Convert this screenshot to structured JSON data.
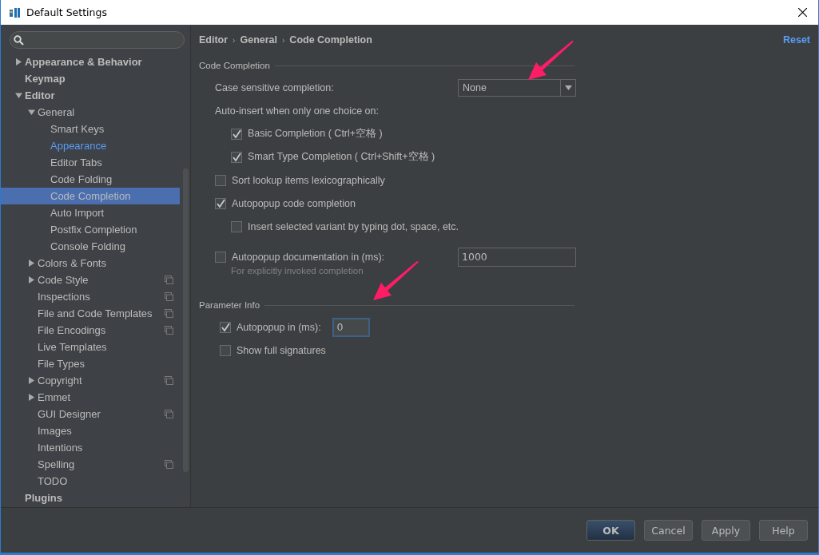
{
  "window": {
    "title": "Default Settings"
  },
  "tree": [
    {
      "label": "Appearance & Behavior",
      "kind": "closed",
      "selected": false,
      "modified": false,
      "project_level": false
    },
    {
      "label": "Keymap",
      "kind": "page",
      "selected": false,
      "modified": false,
      "project_level": false
    },
    {
      "label": "Editor",
      "kind": "open",
      "selected": false,
      "modified": false,
      "project_level": false,
      "children": [
        {
          "label": "General",
          "kind": "open",
          "selected": false,
          "modified": false,
          "project_level": false,
          "children": [
            {
              "label": "Smart Keys",
              "selected": false,
              "modified": false,
              "project_level": false
            },
            {
              "label": "Appearance",
              "selected": false,
              "modified": true,
              "project_level": false
            },
            {
              "label": "Editor Tabs",
              "selected": false,
              "modified": false,
              "project_level": false
            },
            {
              "label": "Code Folding",
              "selected": false,
              "modified": false,
              "project_level": false
            },
            {
              "label": "Code Completion",
              "selected": true,
              "modified": false,
              "project_level": false
            },
            {
              "label": "Auto Import",
              "selected": false,
              "modified": false,
              "project_level": false
            },
            {
              "label": "Postfix Completion",
              "selected": false,
              "modified": false,
              "project_level": false
            },
            {
              "label": "Console Folding",
              "selected": false,
              "modified": false,
              "project_level": false
            }
          ]
        },
        {
          "label": "Colors & Fonts",
          "kind": "closed",
          "selected": false,
          "modified": false,
          "project_level": false
        },
        {
          "label": "Code Style",
          "kind": "closed",
          "selected": false,
          "modified": false,
          "project_level": true
        },
        {
          "label": "Inspections",
          "kind": "page",
          "selected": false,
          "modified": false,
          "project_level": true
        },
        {
          "label": "File and Code Templates",
          "kind": "page",
          "selected": false,
          "modified": false,
          "project_level": true
        },
        {
          "label": "File Encodings",
          "kind": "page",
          "selected": false,
          "modified": false,
          "project_level": true
        },
        {
          "label": "Live Templates",
          "kind": "page",
          "selected": false,
          "modified": false,
          "project_level": false
        },
        {
          "label": "File Types",
          "kind": "page",
          "selected": false,
          "modified": false,
          "project_level": false
        },
        {
          "label": "Copyright",
          "kind": "closed",
          "selected": false,
          "modified": false,
          "project_level": true
        },
        {
          "label": "Emmet",
          "kind": "closed",
          "selected": false,
          "modified": false,
          "project_level": false
        },
        {
          "label": "GUI Designer",
          "kind": "page",
          "selected": false,
          "modified": false,
          "project_level": true
        },
        {
          "label": "Images",
          "kind": "page",
          "selected": false,
          "modified": false,
          "project_level": false
        },
        {
          "label": "Intentions",
          "kind": "page",
          "selected": false,
          "modified": false,
          "project_level": false
        },
        {
          "label": "Spelling",
          "kind": "page",
          "selected": false,
          "modified": false,
          "project_level": true
        },
        {
          "label": "TODO",
          "kind": "page",
          "selected": false,
          "modified": false,
          "project_level": false
        }
      ]
    },
    {
      "label": "Plugins",
      "kind": "page",
      "selected": false,
      "modified": false,
      "project_level": false
    }
  ],
  "breadcrumb": {
    "items": [
      "Editor",
      "General",
      "Code Completion"
    ],
    "separator": "›"
  },
  "reset": "Reset",
  "sections": [
    {
      "title": "Code Completion",
      "rows": [
        {
          "kind": "select",
          "label": "Case sensitive completion:",
          "value": "None"
        },
        {
          "kind": "label",
          "label": "Auto-insert when only one choice on:",
          "children": [
            {
              "kind": "checkbox",
              "label": "Basic Completion ( Ctrl+空格 )",
              "checked": true
            },
            {
              "kind": "checkbox",
              "label": "Smart Type Completion ( Ctrl+Shift+空格 )",
              "checked": true
            }
          ]
        },
        {
          "kind": "checkbox",
          "label": "Sort lookup items lexicographically",
          "checked": false
        },
        {
          "kind": "checkbox",
          "label": "Autopopup code completion",
          "checked": true,
          "children": [
            {
              "kind": "checkbox",
              "label": "Insert selected variant by typing dot, space, etc.",
              "checked": false
            }
          ]
        },
        {
          "kind": "checkbox-field",
          "label": "Autopopup documentation in (ms):",
          "checked": false,
          "value": "1000",
          "focused": false,
          "hint": "For explicitly invoked completion"
        }
      ]
    },
    {
      "title": "Parameter Info",
      "rows": [
        {
          "kind": "checkbox-field",
          "label": "Autopopup in (ms):",
          "checked": true,
          "value": "0",
          "focused": true
        },
        {
          "kind": "checkbox",
          "label": "Show full signatures",
          "checked": false
        }
      ]
    }
  ],
  "buttons": [
    {
      "label": "OK",
      "default": true
    },
    {
      "label": "Cancel",
      "default": false
    },
    {
      "label": "Apply",
      "default": false
    },
    {
      "label": "Help",
      "default": false
    }
  ]
}
